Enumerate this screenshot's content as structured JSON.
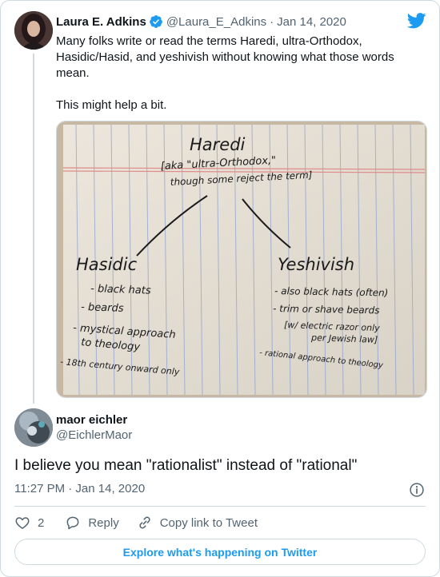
{
  "colors": {
    "brand": "#1d9bf0",
    "text_primary": "#0f1419",
    "text_secondary": "#536471",
    "border": "#cfd9de"
  },
  "parent_tweet": {
    "author_name": "Laura E. Adkins",
    "handle": "@Laura_E_Adkins",
    "separator": "·",
    "date": "Jan 14, 2020",
    "text_paragraphs": [
      "Many folks write or read the terms Haredi, ultra-Orthodox, Hasidic/Hasid, and yeshivish without knowing what those words mean.",
      "This might help a bit."
    ],
    "photo": {
      "handwriting": {
        "title": "Haredi",
        "aka_line1": "[aka \"ultra-Orthodox,\"",
        "aka_line2": "though some reject the term]",
        "left_heading": "Hasidic",
        "left_items": [
          "- black hats",
          "- beards",
          "- mystical approach",
          "to theology",
          "- 18th century onward only"
        ],
        "right_heading": "Yeshivish",
        "right_items": [
          "- also black hats (often)",
          "- trim or shave beards",
          "[w/ electric razor only",
          "per Jewish law]",
          "- rational approach to theology"
        ]
      }
    }
  },
  "reply_tweet": {
    "author_name": "maor eichler",
    "handle": "@EichlerMaor",
    "text": "I believe you mean \"rationalist\" instead of \"rational\"",
    "time": "11:27 PM · Jan 14, 2020"
  },
  "actions": {
    "like_count": "2",
    "reply_label": "Reply",
    "copy_link_label": "Copy link to Tweet"
  },
  "explore_label": "Explore what's happening on Twitter",
  "icons": {
    "bird": "twitter-bird-icon",
    "verified": "verified-badge-icon",
    "info": "info-icon",
    "like": "heart-icon",
    "reply": "speech-bubble-icon",
    "link": "link-icon"
  }
}
